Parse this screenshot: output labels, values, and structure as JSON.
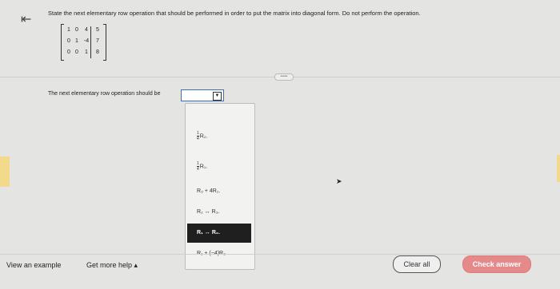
{
  "nav": {
    "back_icon": "arrow-left-bar-icon"
  },
  "question": "State the next elementary row operation that should be performed in order to put the matrix into diagonal form. Do not perform the operation.",
  "matrix": {
    "rows": [
      [
        "1",
        "0",
        "4",
        "5"
      ],
      [
        "0",
        "1",
        "-4",
        "7"
      ],
      [
        "0",
        "0",
        "1",
        "8"
      ]
    ]
  },
  "more_pill": "•••••",
  "prompt_label": "The next elementary row operation should be",
  "select": {
    "value": ""
  },
  "dropdown": {
    "options": [
      {
        "num": "1",
        "den": "4",
        "text": "R₂."
      },
      {
        "num": "1",
        "den": "4",
        "text": "R₁."
      },
      {
        "text": "R₃ + 4R₁."
      },
      {
        "text": "R₂ ↔ R₃."
      },
      {
        "text": "R₁ ↔ R₂."
      },
      {
        "text": "R₁ + (−4)R₃."
      }
    ],
    "selected_index": 4
  },
  "footer": {
    "view_example": "View an example",
    "get_help": "Get more help ▴",
    "clear_all": "Clear all",
    "check_answer": "Check answer"
  },
  "colors": {
    "check_button": "#e58a8a",
    "select_border": "#3d6fb6",
    "highlight": "#f3d98b"
  }
}
